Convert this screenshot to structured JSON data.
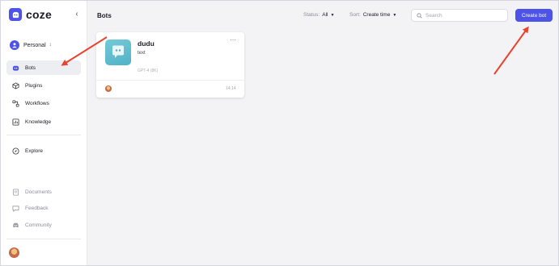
{
  "sidebar": {
    "brand": "coze",
    "workspace": {
      "label": "Personal"
    },
    "nav": [
      {
        "label": "Bots",
        "icon": "bot-icon",
        "active": true
      },
      {
        "label": "Plugins",
        "icon": "cube-icon",
        "active": false
      },
      {
        "label": "Workflows",
        "icon": "workflow-icon",
        "active": false
      },
      {
        "label": "Knowledge",
        "icon": "knowledge-icon",
        "active": false
      }
    ],
    "explore": {
      "label": "Explore",
      "icon": "compass-icon"
    },
    "footer": [
      {
        "label": "Documents",
        "icon": "document-icon"
      },
      {
        "label": "Feedback",
        "icon": "feedback-icon"
      },
      {
        "label": "Community",
        "icon": "discord-icon"
      }
    ]
  },
  "header": {
    "title": "Bots",
    "status": {
      "key": "Status:",
      "value": "All"
    },
    "sort": {
      "key": "Sort:",
      "value": "Create time"
    },
    "search_placeholder": "Search",
    "create_label": "Create bot"
  },
  "bots": [
    {
      "name": "dudu",
      "description": "text",
      "model": "GPT-4 (8K)",
      "time": "14:14"
    }
  ],
  "colors": {
    "accent": "#4d53e8",
    "annotation": "#e8432e"
  }
}
